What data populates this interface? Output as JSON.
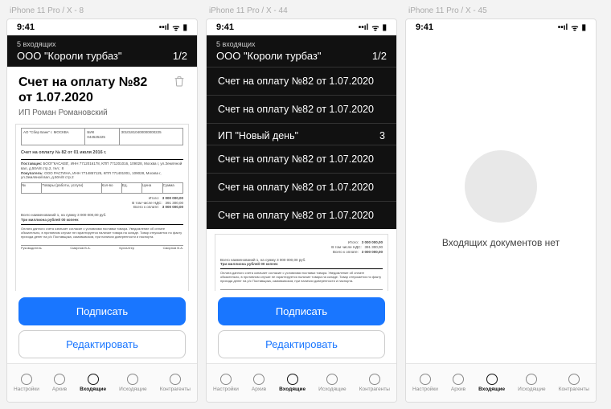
{
  "frames": {
    "f1": "iPhone 11 Pro / X - 8",
    "f2": "iPhone 11 Pro / X - 44",
    "f3": "iPhone 11 Pro / X - 45"
  },
  "status": {
    "time": "9:41",
    "signal": "••ıl",
    "wifi": "⎋",
    "battery": "▮"
  },
  "header": {
    "incoming_small": "5 входящих",
    "org": "ООО \"Короли турбаз\"",
    "page": "1/2"
  },
  "dropdown": {
    "items_a": [
      "Счет на оплату №82 от 1.07.2020",
      "Счет на оплату №82 от 1.07.2020"
    ],
    "group2": {
      "name": "ИП \"Новый день\"",
      "count": "3"
    },
    "items_b": [
      "Счет на оплату №82 от 1.07.2020",
      "Счет на оплату №82 от 1.07.2020",
      "Счет на оплату №82 от 1.07.2020"
    ]
  },
  "doc": {
    "title_line1": "Счет на оплату №82",
    "title_line2": "от 1.07.2020",
    "subtitle": "ИП Роман Романовский"
  },
  "invoice": {
    "bank": "АО \"Сбер Банк\" г. МОСКВА",
    "bik_label": "БИК",
    "bik": "044525225",
    "acc": "30101810400000000225",
    "title": "Счет на оплату № 82 от 01 июля 2016 г.",
    "supplier_label": "Поставщик:",
    "supplier": "БООГ'КАСАЕВ', ИНН 7712016178, КПП 771201016, 109028, Москва г, ул.Земляной вал, д.50А/8 стр.2, тел.: 8",
    "buyer_label": "Покупатель:",
    "buyer": "ООО РАСТИНА, ИНН 7714857125, КПП 771401001, 109028, Москва г, ул.Земляной вал, д.50А/8 стр.2",
    "cols": [
      "№",
      "Товары (работы, услуги)",
      "Кол-во",
      "Ед.",
      "Цена",
      "Сумма"
    ],
    "total_label": "Итого:",
    "total": "3 000 000,00",
    "vat_label": "В том числе НДС:",
    "vat": "391 300,00",
    "grand_label": "Всего к оплате:",
    "grand": "3 000 000,00",
    "sum_text": "Всего наименований 1, на сумму 3 000 000,00 руб.",
    "sum_words": "Три миллиона рублей 00 копеек",
    "note": "Оплата данного счета означает согласие с условиями поставки товара. Уведомление об оплате обязательно, в противном случае не гарантируется наличие товара на складе. Товар отпускается по факту прихода денег на р/с Поставщика, самовывозом, при наличии доверенности и паспорта.",
    "sig1": "Руководитель",
    "sig2": "Смирнов В.А.",
    "sig3": "Бухгалтер",
    "sig4": "Смирнов В.А."
  },
  "buttons": {
    "primary": "Подписать",
    "secondary": "Редактировать"
  },
  "tabs": {
    "t1": "Настройки",
    "t2": "Архив",
    "t3": "Входящие",
    "t4": "Исходящие",
    "t5": "Контрагенты"
  },
  "empty": {
    "text": "Входящих документов нет"
  }
}
